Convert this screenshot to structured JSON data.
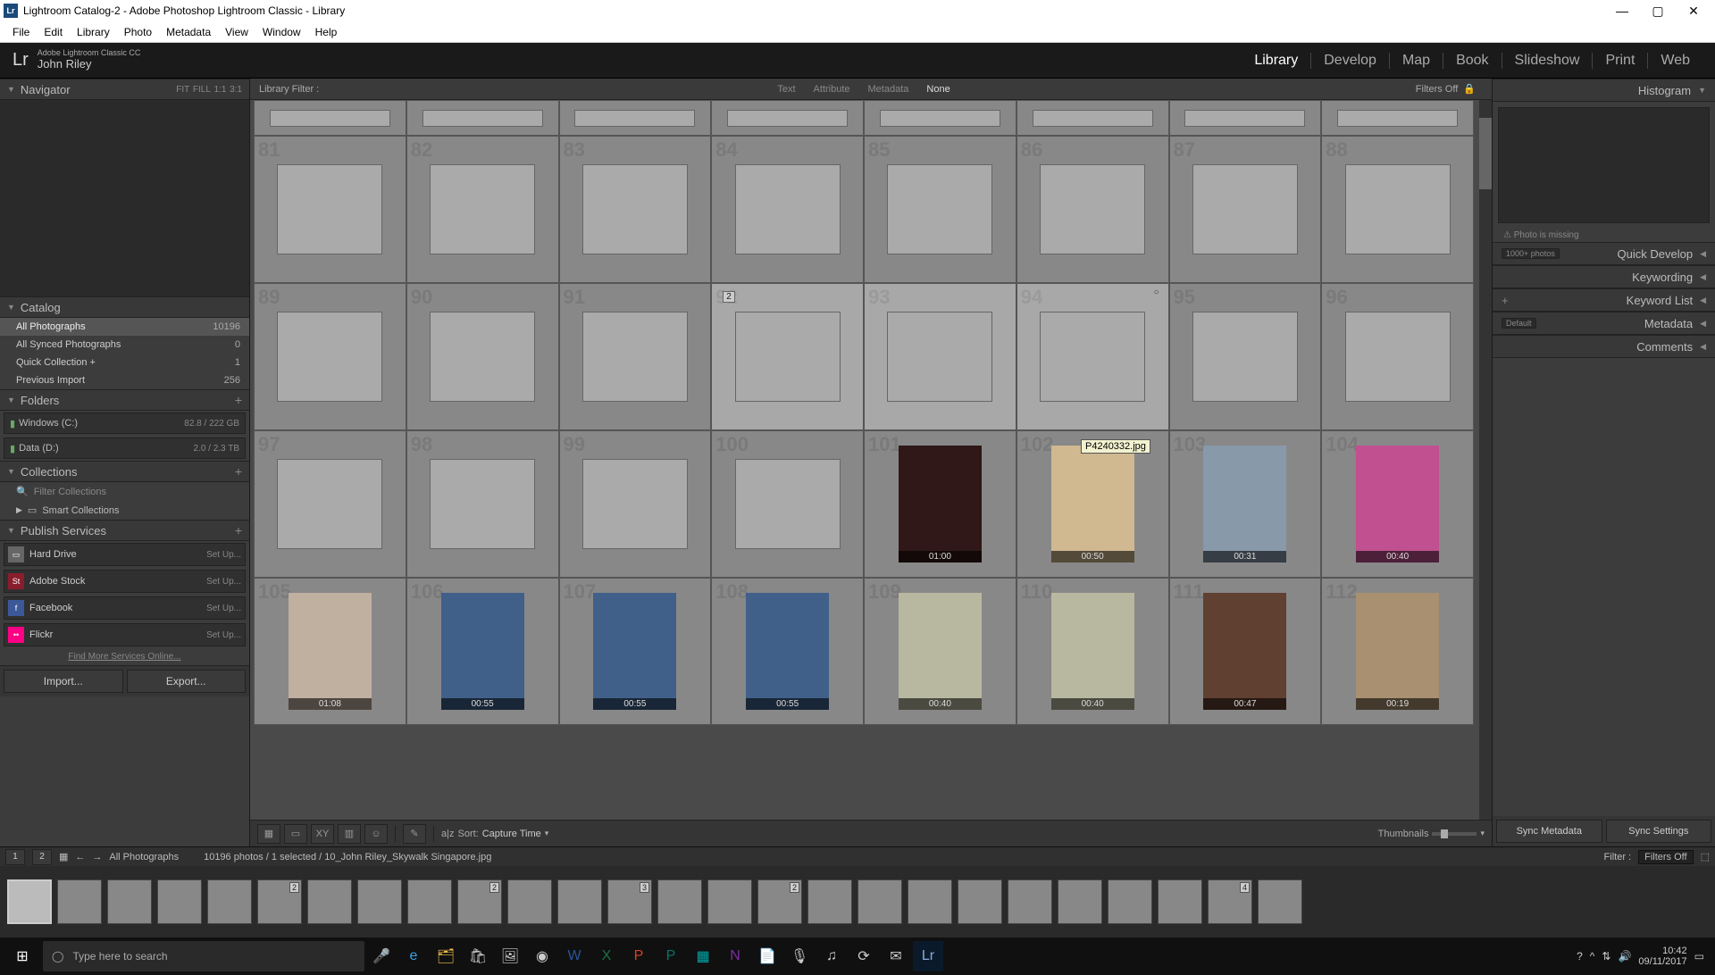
{
  "titlebar": {
    "text": "Lightroom Catalog-2 - Adobe Photoshop Lightroom Classic - Library"
  },
  "menubar": [
    "File",
    "Edit",
    "Library",
    "Photo",
    "Metadata",
    "View",
    "Window",
    "Help"
  ],
  "brand": {
    "line1": "Adobe Lightroom Classic CC",
    "line2": "John Riley"
  },
  "modules": [
    "Library",
    "Develop",
    "Map",
    "Book",
    "Slideshow",
    "Print",
    "Web"
  ],
  "active_module": "Library",
  "navigator": {
    "title": "Navigator",
    "ratios": [
      "FIT",
      "FILL",
      "1:1",
      "3:1"
    ]
  },
  "catalog": {
    "title": "Catalog",
    "items": [
      {
        "label": "All Photographs",
        "count": "10196",
        "sel": true
      },
      {
        "label": "All Synced Photographs",
        "count": "0"
      },
      {
        "label": "Quick Collection  +",
        "count": "1"
      },
      {
        "label": "Previous Import",
        "count": "256"
      }
    ]
  },
  "folders": {
    "title": "Folders",
    "drives": [
      {
        "name": "Windows (C:)",
        "size": "82.8 / 222 GB"
      },
      {
        "name": "Data (D:)",
        "size": "2.0 / 2.3 TB"
      }
    ]
  },
  "collections": {
    "title": "Collections",
    "filter": "Filter Collections",
    "smart": "Smart Collections"
  },
  "publish": {
    "title": "Publish Services",
    "services": [
      {
        "name": "Hard Drive",
        "color": "#666",
        "setup": "Set Up..."
      },
      {
        "name": "Adobe Stock",
        "color": "#8a1d2c",
        "setup": "Set Up...",
        "abbr": "St"
      },
      {
        "name": "Facebook",
        "color": "#3b5998",
        "setup": "Set Up...",
        "abbr": "f"
      },
      {
        "name": "Flickr",
        "color": "#ff0084",
        "setup": "Set Up...",
        "abbr": "••"
      }
    ],
    "find": "Find More Services Online..."
  },
  "leftbuttons": {
    "import": "Import...",
    "export": "Export..."
  },
  "libfilter": {
    "label": "Library Filter :",
    "opts": [
      "Text",
      "Attribute",
      "Metadata",
      "None"
    ],
    "active": "None",
    "off": "Filters Off"
  },
  "grid": {
    "rows": [
      {
        "short": true,
        "cells": [
          {
            "e": 1
          },
          {
            "e": 1
          },
          {
            "e": 1
          },
          {
            "e": 1
          },
          {
            "e": 1
          },
          {
            "e": 1
          },
          {
            "e": 1
          },
          {
            "e": 1
          }
        ]
      },
      {
        "cells": [
          {
            "n": "81"
          },
          {
            "n": "82"
          },
          {
            "n": "83"
          },
          {
            "n": "84"
          },
          {
            "n": "85"
          },
          {
            "n": "86"
          },
          {
            "n": "87"
          },
          {
            "n": "88"
          }
        ]
      },
      {
        "cells": [
          {
            "n": "89"
          },
          {
            "n": "90"
          },
          {
            "n": "91"
          },
          {
            "n": "92",
            "stack": "2",
            "sel": true
          },
          {
            "n": "93",
            "sel": true
          },
          {
            "n": "94",
            "sel": true,
            "ring": true
          },
          {
            "n": "95"
          },
          {
            "n": "96"
          }
        ]
      },
      {
        "cells": [
          {
            "n": "97"
          },
          {
            "n": "98"
          },
          {
            "n": "99"
          },
          {
            "n": "100"
          },
          {
            "n": "101",
            "vid": "01:00",
            "bg": "#301818"
          },
          {
            "n": "102",
            "vid": "00:50",
            "bg": "#d0b890"
          },
          {
            "n": "103",
            "vid": "00:31",
            "bg": "#8899aa"
          },
          {
            "n": "104",
            "vid": "00:40",
            "bg": "#c05090"
          }
        ]
      },
      {
        "cells": [
          {
            "n": "105",
            "vid": "01:08",
            "bg": "#c0b0a0"
          },
          {
            "n": "106",
            "vid": "00:55",
            "bg": "#40608a"
          },
          {
            "n": "107",
            "vid": "00:55",
            "bg": "#40608a"
          },
          {
            "n": "108",
            "vid": "00:55",
            "bg": "#40608a"
          },
          {
            "n": "109",
            "vid": "00:40",
            "bg": "#b8b8a0"
          },
          {
            "n": "110",
            "vid": "00:40",
            "bg": "#b8b8a0"
          },
          {
            "n": "111",
            "vid": "00:47",
            "bg": "#604030"
          },
          {
            "n": "112",
            "vid": "00:19",
            "bg": "#a89070"
          }
        ]
      }
    ],
    "tooltip": "P4240332.jpg"
  },
  "toolbar": {
    "sort_label": "Sort:",
    "sort_value": "Capture Time",
    "thumb": "Thumbnails"
  },
  "rightpanel": {
    "histogram": "Histogram",
    "missing": "Photo is missing",
    "quickdev": "Quick Develop",
    "quickdev_pill": "1000+ photos",
    "keywording": "Keywording",
    "keywordlist": "Keyword List",
    "metadata": "Metadata",
    "metadata_pill": "Default",
    "comments": "Comments",
    "sync_meta": "Sync Metadata",
    "sync_set": "Sync Settings"
  },
  "statusbar": {
    "n1": "1",
    "n2": "2",
    "breadcrumb": "All Photographs",
    "counts": "10196 photos / 1 selected / 10_John Riley_Skywalk Singapore.jpg",
    "filter": "Filter :",
    "filters_off": "Filters Off"
  },
  "filmstrip": {
    "items": [
      {
        "sel": true
      },
      {},
      {},
      {},
      {},
      {
        "b": "2"
      },
      {},
      {},
      {},
      {
        "b": "2"
      },
      {},
      {},
      {
        "b": "3"
      },
      {},
      {},
      {
        "b": "2"
      },
      {},
      {},
      {},
      {},
      {},
      {},
      {},
      {},
      {
        "b": "4"
      },
      {}
    ]
  },
  "taskbar": {
    "search": "Type here to search",
    "clock": {
      "time": "10:42",
      "date": "09/11/2017"
    }
  }
}
